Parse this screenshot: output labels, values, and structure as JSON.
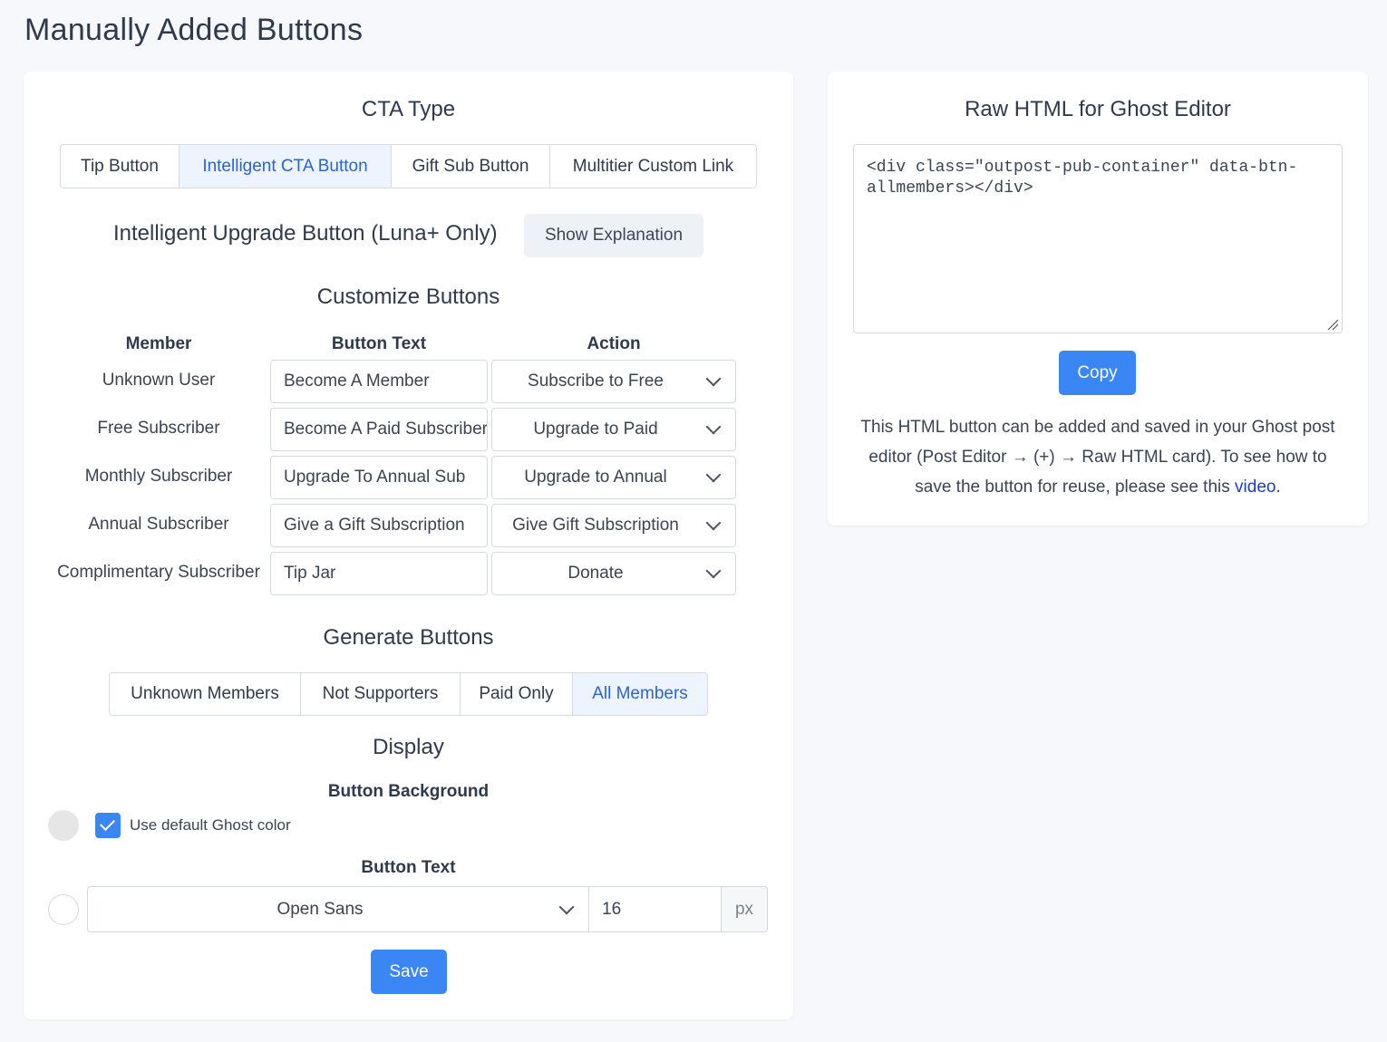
{
  "page": {
    "title": "Manually Added Buttons"
  },
  "colors": {
    "accent": "#3b86f5",
    "active_tab_bg": "#eef4fd",
    "active_tab_text": "#2a63d8",
    "link": "#1a3bd6"
  },
  "cta_type": {
    "title": "CTA Type",
    "tabs": [
      {
        "label": "Tip Button",
        "active": false
      },
      {
        "label": "Intelligent CTA Button",
        "active": true
      },
      {
        "label": "Gift Sub Button",
        "active": false
      },
      {
        "label": "Multitier Custom Link",
        "active": false
      }
    ]
  },
  "upgrade": {
    "heading": "Intelligent Upgrade Button (Luna+ Only)",
    "explain_button": "Show Explanation"
  },
  "customize": {
    "title": "Customize Buttons",
    "columns": {
      "member": "Member",
      "button_text": "Button Text",
      "action": "Action"
    },
    "rows": [
      {
        "member": "Unknown User",
        "button_text": "Become A Member",
        "action": "Subscribe to Free"
      },
      {
        "member": "Free Subscriber",
        "button_text": "Become A Paid Subscriber",
        "action": "Upgrade to Paid"
      },
      {
        "member": "Monthly Subscriber",
        "button_text": "Upgrade To Annual Sub",
        "action": "Upgrade to Annual"
      },
      {
        "member": "Annual Subscriber",
        "button_text": "Give a Gift Subscription",
        "action": "Give Gift Subscription"
      },
      {
        "member": "Complimentary Subscriber",
        "button_text": "Tip Jar",
        "action": "Donate"
      }
    ]
  },
  "generate": {
    "title": "Generate Buttons",
    "tabs": [
      {
        "label": "Unknown Members",
        "active": false
      },
      {
        "label": "Not Supporters",
        "active": false
      },
      {
        "label": "Paid Only",
        "active": false
      },
      {
        "label": "All Members",
        "active": true
      }
    ]
  },
  "display": {
    "title": "Display",
    "background": {
      "title": "Button Background",
      "swatch_color": "#e6e6e6",
      "checkbox_label": "Use default Ghost color",
      "checked": true
    },
    "text": {
      "title": "Button Text",
      "swatch_color": "#ffffff",
      "font": "Open Sans",
      "size": "16",
      "unit": "px"
    },
    "save_label": "Save"
  },
  "raw_html": {
    "title": "Raw HTML for Ghost Editor",
    "code": "<div class=\"outpost-pub-container\" data-btn-allmembers></div>",
    "copy_label": "Copy",
    "note_text": "This HTML button can be added and saved in your Ghost post editor (Post Editor → (+) → Raw HTML card). To see how to save the button for reuse, please see this ",
    "note_link": "video",
    "note_end": "."
  }
}
